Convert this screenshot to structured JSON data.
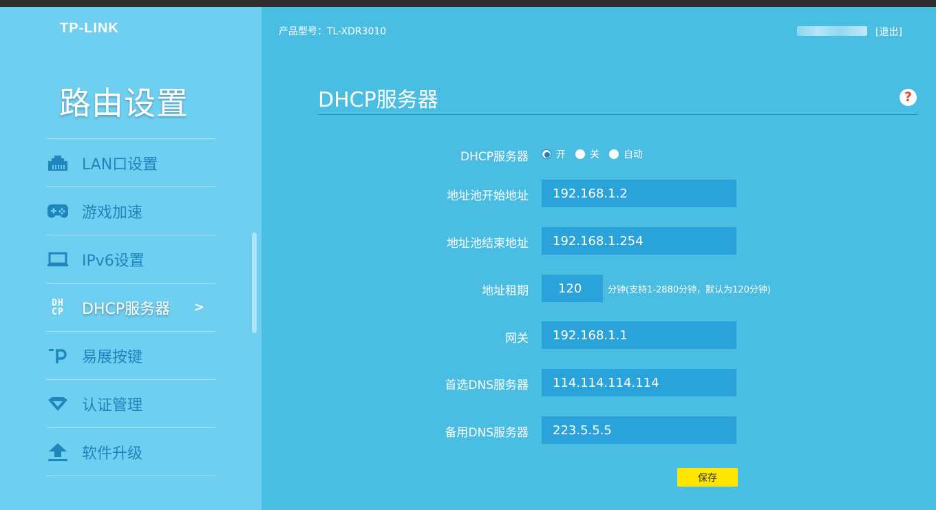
{
  "header": {
    "brand": "TP-LINK",
    "model_label": "产品型号：TL-XDR3010",
    "logout_label": "[退出]"
  },
  "sidebar": {
    "title": "路由设置",
    "items": [
      {
        "label": "LAN口设置",
        "icon": "lan-port-icon"
      },
      {
        "label": "游戏加速",
        "icon": "gamepad-icon"
      },
      {
        "label": "IPv6设置",
        "icon": "monitor-icon"
      },
      {
        "label": "DHCP服务器",
        "icon": "dhcp-icon",
        "active": true,
        "arrow": ">"
      },
      {
        "label": "易展按键",
        "icon": "easymesh-icon"
      },
      {
        "label": "认证管理",
        "icon": "diamond-icon"
      },
      {
        "label": "软件升级",
        "icon": "upload-icon"
      }
    ],
    "dhcp_icon_text": {
      "top": "DH",
      "bottom": "CP"
    }
  },
  "main": {
    "title": "DHCP服务器",
    "help_icon_text": "?",
    "form": {
      "dhcp_server": {
        "label": "DHCP服务器",
        "options": [
          "开",
          "关",
          "自动"
        ],
        "selected": "开"
      },
      "pool_start": {
        "label": "地址池开始地址",
        "value": "192.168.1.2"
      },
      "pool_end": {
        "label": "地址池结束地址",
        "value": "192.168.1.254"
      },
      "lease": {
        "label": "地址租期",
        "value": "120",
        "hint": "分钟(支持1-2880分钟，默认为120分钟)"
      },
      "gateway": {
        "label": "网关",
        "value": "192.168.1.1"
      },
      "dns_primary": {
        "label": "首选DNS服务器",
        "value": "114.114.114.114"
      },
      "dns_backup": {
        "label": "备用DNS服务器",
        "value": "223.5.5.5"
      }
    },
    "save_label": "保存"
  },
  "colors": {
    "main_bg": "#4abde3",
    "sidebar_bg": "#6fcff0",
    "input_bg": "#2aa2da",
    "menu_text": "#1e86bd",
    "save_button": "#ffe600",
    "help_icon": "#e8452c"
  }
}
